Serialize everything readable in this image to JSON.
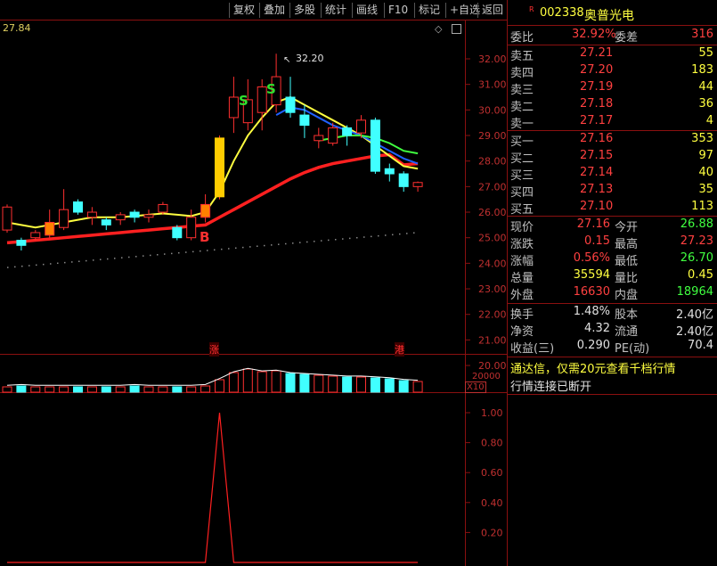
{
  "toolbar": {
    "buttons": [
      "复权",
      "叠加",
      "多股",
      "统计",
      "画线",
      "F10",
      "标记",
      "+自选",
      "返回"
    ]
  },
  "chart_header": {
    "price_top": "27.84",
    "high_marker": "32.20",
    "signal_b": "B",
    "signal_s": "S",
    "tag_zhang": "涨",
    "tag_gang": "港"
  },
  "chart_data": [
    {
      "type": "line",
      "yaxis": [
        "32.00",
        "31.00",
        "30.00",
        "29.00",
        "28.00",
        "27.00",
        "26.00",
        "25.00",
        "24.00",
        "23.00",
        "22.00",
        "21.00",
        "20.00"
      ],
      "candles": [
        {
          "o": 25.3,
          "c": 26.2,
          "h": 26.3,
          "l": 25.2
        },
        {
          "o": 24.9,
          "c": 24.7,
          "h": 25.0,
          "l": 24.5
        },
        {
          "o": 25.0,
          "c": 25.2,
          "h": 25.3,
          "l": 24.9
        },
        {
          "o": 25.1,
          "c": 25.6,
          "h": 26.1,
          "l": 25.0
        },
        {
          "o": 25.4,
          "c": 26.1,
          "h": 26.9,
          "l": 25.3
        },
        {
          "o": 26.4,
          "c": 26.0,
          "h": 26.5,
          "l": 25.9
        },
        {
          "o": 25.8,
          "c": 26.0,
          "h": 26.2,
          "l": 25.5
        },
        {
          "o": 25.7,
          "c": 25.5,
          "h": 25.8,
          "l": 25.3
        },
        {
          "o": 25.7,
          "c": 25.9,
          "h": 26.0,
          "l": 25.5
        },
        {
          "o": 26.0,
          "c": 25.8,
          "h": 26.1,
          "l": 25.6
        },
        {
          "o": 25.8,
          "c": 25.9,
          "h": 26.1,
          "l": 25.6
        },
        {
          "o": 26.0,
          "c": 26.3,
          "h": 26.4,
          "l": 25.9
        },
        {
          "o": 25.4,
          "c": 25.0,
          "h": 25.5,
          "l": 24.9
        },
        {
          "o": 25.0,
          "c": 25.8,
          "h": 26.1,
          "l": 24.9
        },
        {
          "o": 25.8,
          "c": 26.3,
          "h": 26.7,
          "l": 25.6
        },
        {
          "o": 26.6,
          "c": 28.9,
          "h": 29.0,
          "l": 26.5
        },
        {
          "o": 29.7,
          "c": 30.5,
          "h": 31.3,
          "l": 29.1
        },
        {
          "o": 29.5,
          "c": 30.4,
          "h": 31.2,
          "l": 29.2
        },
        {
          "o": 29.9,
          "c": 30.9,
          "h": 31.2,
          "l": 29.2
        },
        {
          "o": 30.2,
          "c": 31.3,
          "h": 32.2,
          "l": 29.9
        },
        {
          "o": 30.5,
          "c": 29.9,
          "h": 31.3,
          "l": 29.7
        },
        {
          "o": 29.8,
          "c": 29.4,
          "h": 30.2,
          "l": 28.9
        },
        {
          "o": 28.8,
          "c": 29.0,
          "h": 29.3,
          "l": 28.5
        },
        {
          "o": 28.7,
          "c": 29.3,
          "h": 29.5,
          "l": 28.6
        },
        {
          "o": 29.3,
          "c": 29.0,
          "h": 29.4,
          "l": 28.6
        },
        {
          "o": 29.1,
          "c": 29.6,
          "h": 29.8,
          "l": 28.9
        },
        {
          "o": 29.6,
          "c": 27.6,
          "h": 29.7,
          "l": 27.5
        },
        {
          "o": 27.7,
          "c": 27.5,
          "h": 27.9,
          "l": 27.2
        },
        {
          "o": 27.5,
          "c": 27.0,
          "h": 27.6,
          "l": 26.8
        },
        {
          "o": 27.0,
          "c": 27.16,
          "h": 27.2,
          "l": 26.8
        }
      ],
      "ma_red": [
        24.8,
        24.85,
        24.9,
        24.95,
        25.0,
        25.05,
        25.1,
        25.15,
        25.2,
        25.25,
        25.3,
        25.35,
        25.4,
        25.45,
        25.5,
        25.8,
        26.1,
        26.4,
        26.7,
        27.0,
        27.3,
        27.55,
        27.75,
        27.9,
        28.0,
        28.1,
        28.2,
        28.25,
        27.85,
        27.9
      ],
      "ma_yellow": [
        25.6,
        25.5,
        25.4,
        25.5,
        25.6,
        25.7,
        25.8,
        25.8,
        25.8,
        25.85,
        25.9,
        25.95,
        25.9,
        25.85,
        26.0,
        26.8,
        28.0,
        29.0,
        29.7,
        30.3,
        30.5,
        30.2,
        29.9,
        29.6,
        29.3,
        29.0,
        28.6,
        28.2,
        27.8,
        27.7
      ],
      "ma_blue": [
        null,
        null,
        null,
        null,
        null,
        null,
        null,
        null,
        null,
        null,
        null,
        null,
        null,
        null,
        null,
        null,
        null,
        null,
        null,
        29.8,
        30.1,
        30.0,
        29.7,
        29.4,
        29.2,
        29.0,
        28.7,
        28.4,
        28.1,
        27.9
      ],
      "ma_green": [
        null,
        null,
        null,
        null,
        null,
        null,
        null,
        null,
        null,
        null,
        null,
        null,
        null,
        null,
        null,
        null,
        null,
        null,
        null,
        null,
        null,
        null,
        28.8,
        28.9,
        29.0,
        29.0,
        28.9,
        28.7,
        28.4,
        28.3
      ]
    },
    {
      "type": "bar",
      "label": "20000",
      "unit": "X10",
      "values": [
        6,
        7,
        6,
        6,
        6,
        6,
        6,
        6,
        6,
        7,
        6,
        6,
        6,
        6,
        7,
        14,
        22,
        26,
        23,
        24,
        21,
        20,
        19,
        18,
        17,
        17,
        16,
        15,
        13,
        12
      ]
    },
    {
      "type": "line",
      "yaxis": [
        "1.00",
        "0.80",
        "0.60",
        "0.40",
        "0.20"
      ],
      "values": [
        0,
        0,
        0,
        0,
        0,
        0,
        0,
        0,
        0,
        0,
        0,
        0,
        0,
        0,
        0,
        1,
        0,
        0,
        0,
        0,
        0,
        0,
        0,
        0,
        0,
        0,
        0,
        0,
        0,
        0
      ]
    }
  ],
  "quote": {
    "code": "002338",
    "name": "奥普光电",
    "r_mark": "R",
    "weibi_label": "委比",
    "weibi": "32.92%",
    "weicha_label": "委差",
    "weicha": "316",
    "sells": [
      {
        "label": "卖五",
        "price": "27.21",
        "vol": "55"
      },
      {
        "label": "卖四",
        "price": "27.20",
        "vol": "183"
      },
      {
        "label": "卖三",
        "price": "27.19",
        "vol": "44"
      },
      {
        "label": "卖二",
        "price": "27.18",
        "vol": "36"
      },
      {
        "label": "卖一",
        "price": "27.17",
        "vol": "4"
      }
    ],
    "buys": [
      {
        "label": "买一",
        "price": "27.16",
        "vol": "353"
      },
      {
        "label": "买二",
        "price": "27.15",
        "vol": "97"
      },
      {
        "label": "买三",
        "price": "27.14",
        "vol": "40"
      },
      {
        "label": "买四",
        "price": "27.13",
        "vol": "35"
      },
      {
        "label": "买五",
        "price": "27.10",
        "vol": "113"
      }
    ],
    "stats": [
      {
        "l1": "现价",
        "v1": "27.16",
        "l2": "今开",
        "v2": "26.88",
        "c1": "red",
        "c2": "green"
      },
      {
        "l1": "涨跌",
        "v1": "0.15",
        "l2": "最高",
        "v2": "27.23",
        "c1": "red",
        "c2": "red"
      },
      {
        "l1": "涨幅",
        "v1": "0.56%",
        "l2": "最低",
        "v2": "26.70",
        "c1": "red",
        "c2": "green"
      },
      {
        "l1": "总量",
        "v1": "35594",
        "l2": "量比",
        "v2": "0.45",
        "c1": "yellow",
        "c2": "yellow"
      },
      {
        "l1": "外盘",
        "v1": "16630",
        "l2": "内盘",
        "v2": "18964",
        "c1": "red",
        "c2": "green"
      }
    ],
    "fund": [
      {
        "l1": "换手",
        "v1": "1.48%",
        "l2": "股本",
        "v2": "2.40亿"
      },
      {
        "l1": "净资",
        "v1": "4.32",
        "l2": "流通",
        "v2": "2.40亿"
      },
      {
        "l1": "收益(三)",
        "v1": "0.290",
        "l2": "PE(动)",
        "v2": "70.4"
      }
    ],
    "notice": "通达信，仅需20元查看千档行情",
    "status": "行情连接已断开"
  },
  "colors": {
    "up": "#ff3030",
    "down": "#40ffff",
    "ma_yellow": "#ffff40",
    "ma_red": "#ff2020",
    "ma_blue": "#2060ff",
    "ma_green": "#40ff40",
    "frame": "#8a1010"
  }
}
